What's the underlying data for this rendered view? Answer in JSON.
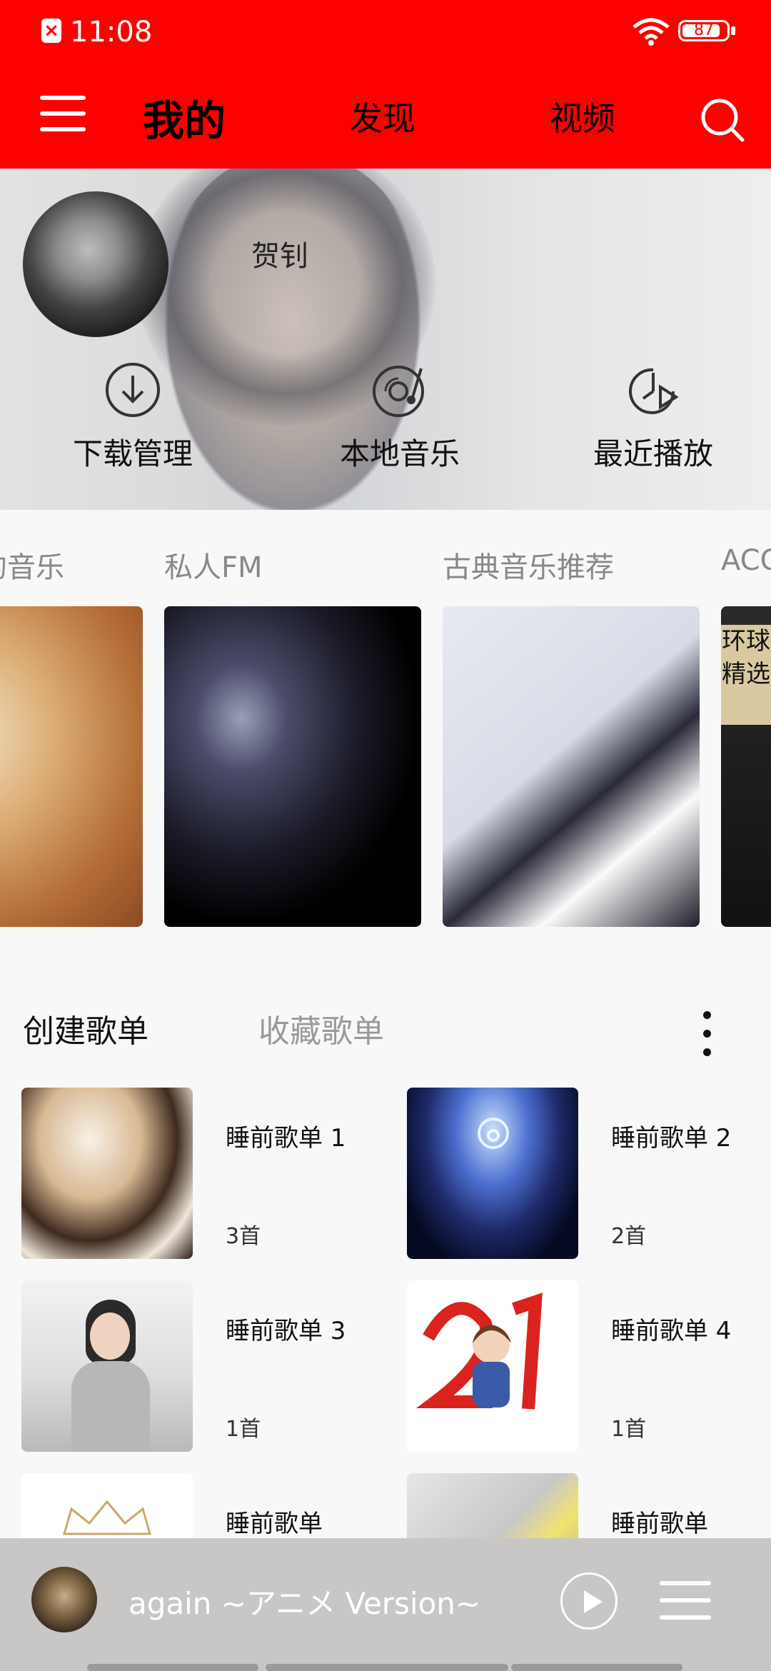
{
  "status_bar": {
    "time": "11:08",
    "battery": "87",
    "battery_level": 0.87,
    "alert": "×"
  },
  "header": {
    "tab_mine": "我的",
    "tab_discover": "发现",
    "tab_video": "视频"
  },
  "profile": {
    "username": "贺钊"
  },
  "quick_actions": [
    {
      "label": "下载管理",
      "icon": "download-icon"
    },
    {
      "label": "本地音乐",
      "icon": "vinyl-note-icon"
    },
    {
      "label": "最近播放",
      "icon": "history-play-icon"
    }
  ],
  "recommend": {
    "items": [
      {
        "label": "的音乐"
      },
      {
        "label": "私人FM"
      },
      {
        "label": "古典音乐推荐"
      },
      {
        "label": "ACG",
        "cover_text": "环球精选"
      }
    ]
  },
  "playlists": {
    "tab_created": "创建歌单",
    "tab_favorited": "收藏歌单",
    "items": [
      {
        "name": "睡前歌单 1",
        "count": "3首"
      },
      {
        "name": "睡前歌单 2",
        "count": "2首"
      },
      {
        "name": "睡前歌单 3",
        "count": "1首"
      },
      {
        "name": "睡前歌单 4",
        "count": "1首"
      },
      {
        "name": "睡前歌单",
        "count": ""
      },
      {
        "name": "睡前歌单",
        "count": ""
      }
    ]
  },
  "player": {
    "title": "again ~アニメ Version~"
  },
  "colors": {
    "brand_red": "#ff0000",
    "player_bg": "#c9c6c6"
  }
}
